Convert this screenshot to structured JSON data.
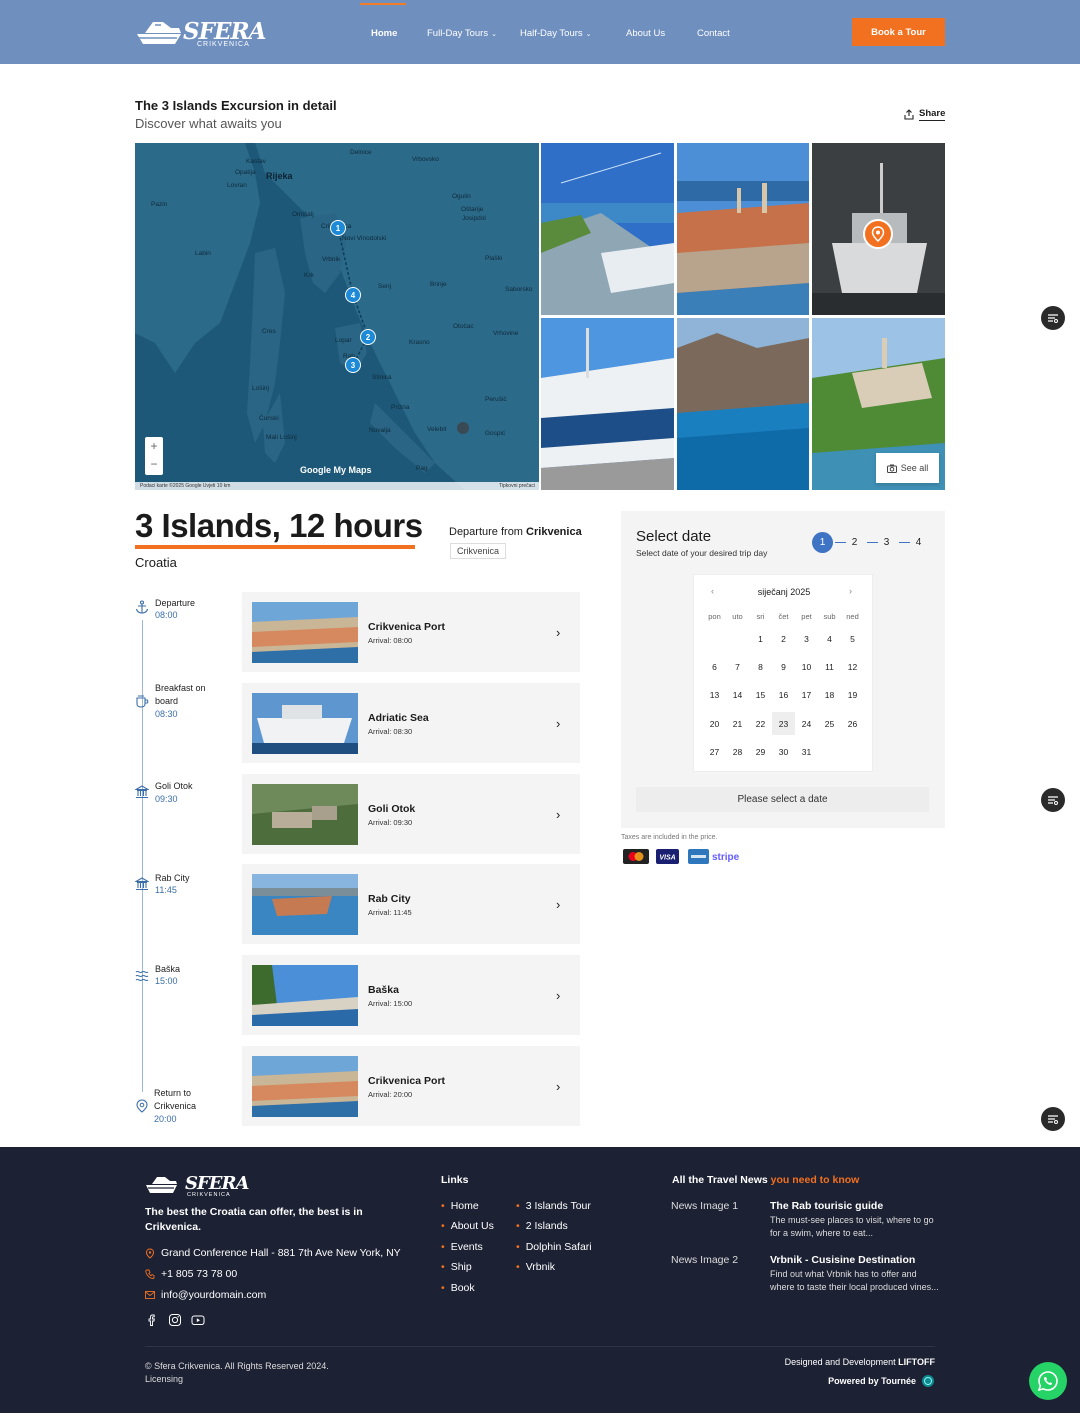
{
  "header": {
    "logo_text": "SFERA",
    "logo_sub": "CRIKVENICA",
    "nav": [
      {
        "label": "Home",
        "active": true
      },
      {
        "label": "Full-Day Tours",
        "dropdown": true
      },
      {
        "label": "Half-Day Tours",
        "dropdown": true
      },
      {
        "label": "About Us"
      },
      {
        "label": "Contact"
      }
    ],
    "book_button": "Book a Tour"
  },
  "intro": {
    "title": "The 3 Islands Excursion in detail",
    "subtitle": "Discover what awaits you",
    "share": "Share"
  },
  "map": {
    "labels": [
      "Delnice",
      "Kastav",
      "Opatija",
      "Rijeka",
      "Vrbovsko",
      "Lovran",
      "Pazin",
      "Ogulin",
      "Omišalj",
      "Crikvenica",
      "Novi Vinodolski",
      "Oštarije",
      "Josipdol",
      "Labin",
      "Vrbnik",
      "Plaški",
      "Krk",
      "Senj",
      "Brinje",
      "Saborsko",
      "Cres",
      "Otočac",
      "Vrhovine",
      "Lopar",
      "Krasno",
      "Rab",
      "Stinica",
      "Lošinj",
      "Prizna",
      "Perušić",
      "Ćunski",
      "Velebit",
      "Novalja",
      "Mali Lošinj",
      "Gospić",
      "Pag"
    ],
    "pins": [
      "1",
      "4",
      "2",
      "3"
    ],
    "logo": "Google My Maps",
    "footer_left": "Podaci karte ©2025 Google   Uvjeti   10 km",
    "footer_right": "Tipkovni prečaci"
  },
  "gallery": {
    "see_all": "See all"
  },
  "tour": {
    "title": "3 Islands, 12 hours",
    "country": "Croatia",
    "departure_prefix": "Departure from",
    "departure_city": "Crikvenica",
    "departure_tag": "Crikvenica"
  },
  "timeline": [
    {
      "label": "Departure",
      "time": "08:00",
      "icon": "anchor-icon"
    },
    {
      "label": "Breakfast on board",
      "time": "08:30",
      "icon": "coffee-cup-icon"
    },
    {
      "label": "Goli Otok",
      "time": "09:30",
      "icon": "landmark-icon"
    },
    {
      "label": "Rab City",
      "time": "11:45",
      "icon": "landmark-icon"
    },
    {
      "label": "Baška",
      "time": "15:00",
      "icon": "waves-icon"
    },
    {
      "label": "Return to Crikvenica",
      "time": "20:00",
      "icon": "map-pin-icon"
    }
  ],
  "stops": [
    {
      "name": "Crikvenica Port",
      "arrival": "Arrival: 08:00"
    },
    {
      "name": "Adriatic Sea",
      "arrival": "Arrival: 08:30"
    },
    {
      "name": "Goli Otok",
      "arrival": "Arrival: 09:30"
    },
    {
      "name": "Rab City",
      "arrival": "Arrival: 11:45"
    },
    {
      "name": "Baška",
      "arrival": "Arrival: 15:00"
    },
    {
      "name": "Crikvenica Port",
      "arrival": "Arrival: 20:00"
    }
  ],
  "booking": {
    "title": "Select date",
    "subtitle": "Select date of your desired trip day",
    "steps": [
      "1",
      "2",
      "3",
      "4"
    ],
    "active_step": 1,
    "calendar": {
      "month": "siječanj 2025",
      "weekdays": [
        "pon",
        "uto",
        "sri",
        "čet",
        "pet",
        "sub",
        "ned"
      ],
      "first_weekday_index": 2,
      "days_in_month": 31,
      "today": 23
    },
    "please_select": "Please select a date",
    "taxes": "Taxes are included in the price.",
    "payment_methods": [
      "mastercard",
      "VISA",
      "amex",
      "stripe"
    ]
  },
  "footer": {
    "logo_text": "SFERA",
    "logo_sub": "CRIKVENICA",
    "tagline": "The best the Croatia can offer, the best is in Crikvenica.",
    "address": "Grand Conference Hall - 881 7th Ave New York, NY",
    "phone": "+1 805 73 78 00",
    "email": "info@yourdomain.com",
    "links_title": "Links",
    "links_col1": [
      "Home",
      "About Us",
      "Events",
      "Ship",
      "Book"
    ],
    "links_col2": [
      "3 Islands Tour",
      "2 Islands",
      "Dolphin Safari",
      "Vrbnik"
    ],
    "news_title_a": "All the Travel News",
    "news_title_b": "you need to know",
    "news": [
      {
        "img_alt": "News Image 1",
        "title": "The Rab tourisic guide",
        "text": "The must-see places to visit, where to go for a swim, where to eat..."
      },
      {
        "img_alt": "News Image 2",
        "title": "Vrbnik - Cusisine Destination",
        "text": "Find out what Vrbnik has to offer and where to taste their local produced vines..."
      }
    ],
    "copyright": "© Sfera Crikvenica. All Rights Reserved 2024.",
    "licensing": "Licensing",
    "designed_prefix": "Designed and Development",
    "designed_brand": "LIFTOFF",
    "powered": "Powered by Tournée"
  },
  "colors": {
    "header": "#6f8fbf",
    "accent": "#f27120",
    "primary_blue": "#3f73c4",
    "footer": "#1c2133"
  }
}
